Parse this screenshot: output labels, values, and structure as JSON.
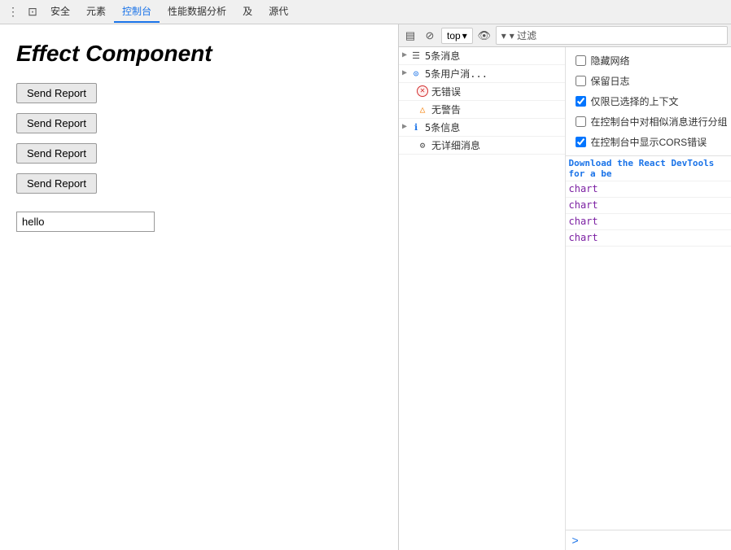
{
  "page": {
    "title": "Effect Component"
  },
  "buttons": [
    {
      "label": "Send Report"
    },
    {
      "label": "Send Report"
    },
    {
      "label": "Send Report"
    },
    {
      "label": "Send Report"
    }
  ],
  "input": {
    "value": "hello",
    "placeholder": ""
  },
  "devtools": {
    "tabs": [
      {
        "label": "元素",
        "active": false
      },
      {
        "label": "控制台",
        "active": true
      },
      {
        "label": "性能数据分析",
        "active": false
      },
      {
        "label": "及",
        "active": false
      },
      {
        "label": "源代",
        "active": false
      }
    ],
    "top_tabs": [
      {
        "label": "安全",
        "active": false
      }
    ],
    "icons": {
      "sidebar": "☰",
      "block": "⊡",
      "filter_icon": "⊘"
    },
    "top_dropdown": {
      "label": "top",
      "arrow": "▾"
    },
    "filter_placeholder": "过滤",
    "settings_icon": "👁",
    "filter_btn": "▾ 过滤"
  },
  "console": {
    "settings": {
      "hide_network": {
        "label": "隐藏网络",
        "checked": false
      },
      "keep_log": {
        "label": "保留日志",
        "checked": false
      },
      "only_selected_context": {
        "label": "仅限已选择的上下文",
        "checked": true
      },
      "group_similar": {
        "label": "在控制台中对相似消息进行分组",
        "checked": false
      },
      "show_cors": {
        "label": "在控制台中显示CORS错误",
        "checked": true
      }
    },
    "messages": [
      {
        "type": "expand",
        "icon": "list",
        "count": "5条消息",
        "has_arrow": true
      },
      {
        "type": "expand",
        "icon": "user",
        "count": "5条用户消...",
        "has_arrow": true
      },
      {
        "type": "error",
        "icon": "✕",
        "text": "无错误",
        "has_arrow": false
      },
      {
        "type": "warn",
        "icon": "△",
        "text": "无警告",
        "has_arrow": false
      },
      {
        "type": "info",
        "icon": "ℹ",
        "count": "5条信息",
        "has_arrow": true
      },
      {
        "type": "log",
        "icon": "⚙",
        "text": "无详细消息",
        "has_arrow": false
      }
    ],
    "output_messages": [
      {
        "type": "link",
        "text": "Download the React DevTools for a be"
      },
      {
        "type": "chart",
        "text": "chart"
      },
      {
        "type": "chart",
        "text": "chart"
      },
      {
        "type": "chart",
        "text": "chart"
      },
      {
        "type": "chart",
        "text": "chart"
      }
    ],
    "prompt_arrow": ">"
  }
}
